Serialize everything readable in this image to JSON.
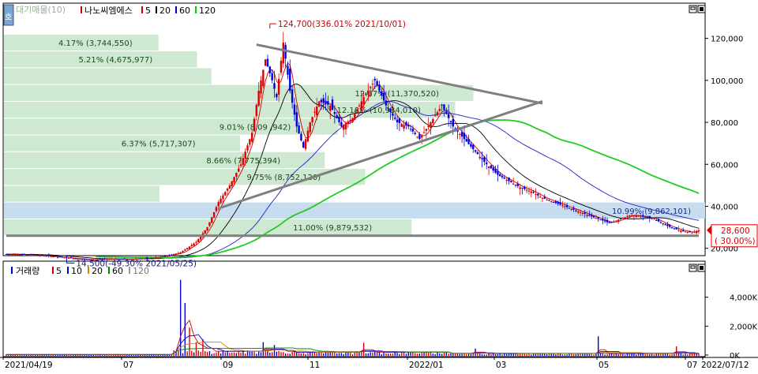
{
  "top_panel": {
    "legend_prefix": "대기매물(10)",
    "legend": [
      {
        "label": "나노씨엠에스",
        "color": "#cc0000"
      },
      {
        "label": "5",
        "color": "#cc0000"
      },
      {
        "label": "20",
        "color": "#000000"
      },
      {
        "label": "60",
        "color": "#0000cc"
      },
      {
        "label": "120",
        "color": "#00cc00"
      }
    ],
    "side_button": "호",
    "window_icons": [
      "restore-icon",
      "close-icon"
    ]
  },
  "bottom_panel": {
    "legend_prefix": "거래량",
    "legend": [
      {
        "label": "5",
        "color": "#cc0000"
      },
      {
        "label": "10",
        "color": "#0000cc"
      },
      {
        "label": "20",
        "color": "#cc8800"
      },
      {
        "label": "60",
        "color": "#008800"
      },
      {
        "label": "120",
        "color": "#999999"
      }
    ],
    "window_icons": [
      "restore-icon",
      "close-icon"
    ]
  },
  "chart_data": [
    {
      "type": "candlestick",
      "title": "나노씨엠에스",
      "ylim": [
        18000,
        130000
      ],
      "y_ticks": [
        {
          "value": 120000,
          "label": "120,000"
        },
        {
          "value": 100000,
          "label": "100,000"
        },
        {
          "value": 80000,
          "label": "80,000"
        },
        {
          "value": 60000,
          "label": "60,000"
        },
        {
          "value": 40000,
          "label": "40,000"
        },
        {
          "value": 20000,
          "label": "20,000"
        }
      ],
      "x_labels": [
        "2021/04/19",
        "07",
        "09",
        "11",
        "2022/01",
        "03",
        "05",
        "07",
        "2022/07/12"
      ],
      "high_annotation": {
        "text": "124,700(336.01% 2021/10/01)",
        "value": 124700,
        "date": "2021/10/01"
      },
      "low_annotation": {
        "text": "14,500(-49.30% 2021/05/25)",
        "value": 14500,
        "date": "2021/05/25"
      },
      "current_price": {
        "text": "28,600",
        "change": "( 30.00%)"
      },
      "volume_profile": [
        {
          "low": 114000,
          "high": 122000,
          "label": "4.17% (3,744,550)",
          "share": 4.17
        },
        {
          "low": 106000,
          "high": 114000,
          "label": "5.21% (4,675,977)",
          "share": 5.21
        },
        {
          "low": 98000,
          "high": 106000,
          "label": "",
          "share": 5.6
        },
        {
          "low": 90000,
          "high": 98000,
          "label": "12.67% (11,370,520)",
          "share": 12.67
        },
        {
          "low": 82000,
          "high": 90000,
          "label": "12.18% (10,934,010)",
          "share": 12.18
        },
        {
          "low": 74000,
          "high": 82000,
          "label": "9.01% (8,09 ,942)",
          "share": 9.01
        },
        {
          "low": 66000,
          "high": 74000,
          "label": "6.37% (5,717,307)",
          "share": 6.37
        },
        {
          "low": 58000,
          "high": 66000,
          "label": "8.66% (7,775,394)",
          "share": 8.66
        },
        {
          "low": 50000,
          "high": 58000,
          "label": "9.75% (8,752,120)",
          "share": 9.75
        },
        {
          "low": 42000,
          "high": 50000,
          "label": "",
          "share": 4.2
        },
        {
          "low": 34000,
          "high": 42000,
          "label": "10.99% (9,862,101)",
          "share": 10.99,
          "highlight": true
        },
        {
          "low": 26000,
          "high": 34000,
          "label": "11.00% (9,879,532)",
          "share": 11.0
        }
      ],
      "price_path": [
        [
          0,
          17200
        ],
        [
          10,
          17000
        ],
        [
          20,
          16200
        ],
        [
          30,
          15200
        ],
        [
          38,
          14500
        ],
        [
          45,
          15000
        ],
        [
          55,
          14900
        ],
        [
          65,
          15300
        ],
        [
          72,
          16500
        ],
        [
          78,
          18000
        ],
        [
          85,
          23000
        ],
        [
          90,
          30000
        ],
        [
          95,
          42000
        ],
        [
          100,
          50000
        ],
        [
          105,
          60000
        ],
        [
          110,
          75000
        ],
        [
          113,
          95000
        ],
        [
          116,
          110000
        ],
        [
          119,
          100000
        ],
        [
          121,
          92000
        ],
        [
          124,
          118000
        ],
        [
          127,
          95000
        ],
        [
          130,
          78000
        ],
        [
          133,
          68000
        ],
        [
          136,
          80000
        ],
        [
          140,
          90000
        ],
        [
          145,
          88000
        ],
        [
          150,
          78000
        ],
        [
          155,
          82000
        ],
        [
          160,
          92000
        ],
        [
          165,
          100000
        ],
        [
          170,
          88000
        ],
        [
          175,
          80000
        ],
        [
          180,
          78000
        ],
        [
          185,
          72000
        ],
        [
          190,
          80000
        ],
        [
          195,
          88000
        ],
        [
          200,
          78000
        ],
        [
          205,
          72000
        ],
        [
          210,
          66000
        ],
        [
          215,
          60000
        ],
        [
          220,
          55000
        ],
        [
          225,
          52000
        ],
        [
          230,
          49000
        ],
        [
          235,
          47000
        ],
        [
          240,
          44000
        ],
        [
          245,
          42000
        ],
        [
          250,
          40000
        ],
        [
          255,
          38000
        ],
        [
          260,
          36000
        ],
        [
          265,
          34000
        ],
        [
          270,
          32000
        ],
        [
          275,
          34000
        ],
        [
          280,
          36000
        ],
        [
          285,
          35000
        ],
        [
          290,
          34000
        ],
        [
          295,
          31000
        ],
        [
          300,
          29000
        ],
        [
          304,
          28000
        ],
        [
          307,
          27500
        ],
        [
          310,
          28600
        ]
      ],
      "trendlines": [
        {
          "from": [
            95,
            39000
          ],
          "to": [
            240,
            90000
          ]
        },
        {
          "from": [
            112,
            117000
          ],
          "to": [
            240,
            89000
          ]
        },
        {
          "from": [
            0,
            26000
          ],
          "to": [
            310,
            26000
          ]
        }
      ],
      "moving_averages": [
        {
          "period": 5,
          "color": "#cc0000"
        },
        {
          "period": 20,
          "color": "#000000"
        },
        {
          "period": 60,
          "color": "#2020cc"
        },
        {
          "period": 120,
          "color": "#22cc22"
        }
      ]
    },
    {
      "type": "bar",
      "title": "거래량",
      "ylim": [
        0,
        5400
      ],
      "y_ticks": [
        {
          "value": 4000,
          "label": "4,000K"
        },
        {
          "value": 2000,
          "label": "2,000K"
        },
        {
          "value": 0,
          "label": "0K"
        }
      ],
      "spikes": [
        [
          78,
          5200
        ],
        [
          80,
          3600
        ],
        [
          82,
          1900
        ],
        [
          85,
          900
        ],
        [
          88,
          1100
        ],
        [
          115,
          900
        ],
        [
          120,
          700
        ],
        [
          160,
          850
        ],
        [
          210,
          450
        ],
        [
          265,
          1300
        ],
        [
          300,
          600
        ]
      ]
    }
  ]
}
